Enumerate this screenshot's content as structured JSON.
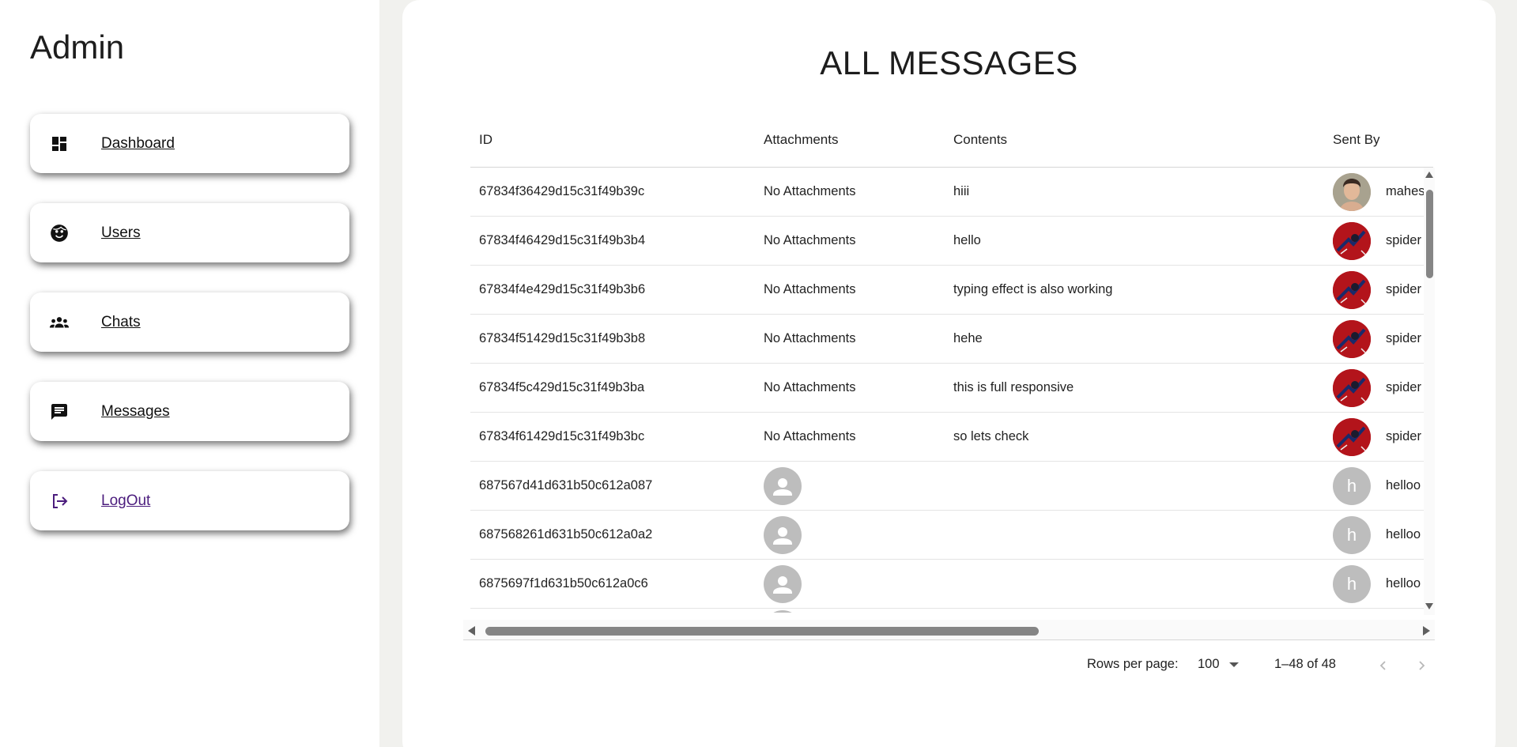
{
  "sidebar": {
    "title": "Admin",
    "items": [
      {
        "label": "Dashboard",
        "icon": "dashboard-icon"
      },
      {
        "label": "Users",
        "icon": "face-icon"
      },
      {
        "label": "Chats",
        "icon": "groups-icon"
      },
      {
        "label": "Messages",
        "icon": "message-icon"
      },
      {
        "label": "LogOut",
        "icon": "logout-icon"
      }
    ]
  },
  "main": {
    "title": "ALL MESSAGES",
    "columns": [
      "ID",
      "Attachments",
      "Contents",
      "Sent By"
    ],
    "rows": [
      {
        "id": "67834f36429d15c31f49b39c",
        "attachments": "No Attachments",
        "contents": "hiii",
        "sent_by": "mahes",
        "avatar": "person-photo"
      },
      {
        "id": "67834f46429d15c31f49b3b4",
        "attachments": "No Attachments",
        "contents": "hello",
        "sent_by": "spider",
        "avatar": "spider-photo"
      },
      {
        "id": "67834f4e429d15c31f49b3b6",
        "attachments": "No Attachments",
        "contents": "typing effect is also working",
        "sent_by": "spider",
        "avatar": "spider-photo"
      },
      {
        "id": "67834f51429d15c31f49b3b8",
        "attachments": "No Attachments",
        "contents": "hehe",
        "sent_by": "spider",
        "avatar": "spider-photo"
      },
      {
        "id": "67834f5c429d15c31f49b3ba",
        "attachments": "No Attachments",
        "contents": "this is full responsive",
        "sent_by": "spider",
        "avatar": "spider-photo"
      },
      {
        "id": "67834f61429d15c31f49b3bc",
        "attachments": "No Attachments",
        "contents": "so lets check",
        "sent_by": "spider",
        "avatar": "spider-photo"
      },
      {
        "id": "687567d41d631b50c612a087",
        "attachments": "",
        "contents": "",
        "sent_by": "helloo",
        "avatar_letter": "h"
      },
      {
        "id": "687568261d631b50c612a0a2",
        "attachments": "",
        "contents": "",
        "sent_by": "helloo",
        "avatar_letter": "h"
      },
      {
        "id": "6875697f1d631b50c612a0c6",
        "attachments": "",
        "contents": "",
        "sent_by": "helloo",
        "avatar_letter": "h"
      }
    ],
    "pagination": {
      "rows_per_page_label": "Rows per page:",
      "rows_per_page": "100",
      "range": "1–48 of 48"
    }
  },
  "colors": {
    "page_bg": "#f1f1ee",
    "logout": "#4b1c7d",
    "scroll_thumb": "#858585",
    "avatar_default": "#bdbdbd"
  }
}
